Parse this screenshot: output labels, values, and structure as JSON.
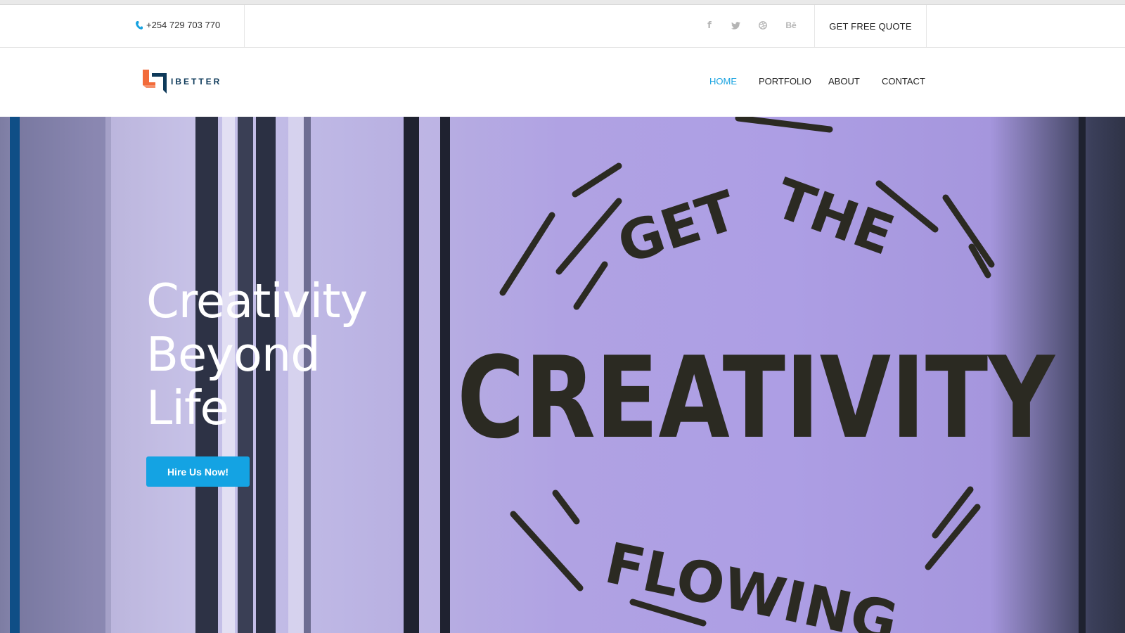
{
  "topbar": {
    "phone": "+254 729 703 770",
    "social": [
      {
        "icon": "facebook-icon",
        "glyph": "f"
      },
      {
        "icon": "twitter-icon",
        "glyph": "t"
      },
      {
        "icon": "dribbble-icon",
        "glyph": "⊛"
      },
      {
        "icon": "behance-icon",
        "glyph": "Bē"
      }
    ],
    "quote_label": "GET FREE QUOTE"
  },
  "brand": {
    "name": "IBETTER",
    "colors": {
      "orange": "#f26b3a",
      "navy": "#0e3a5a"
    }
  },
  "nav": {
    "items": [
      {
        "label": "HOME",
        "active": true
      },
      {
        "label": "PORTFOLIO",
        "active": false
      },
      {
        "label": "ABOUT",
        "active": false
      },
      {
        "label": "CONTACT",
        "active": false
      }
    ],
    "active_color": "#17a2e0"
  },
  "hero": {
    "title_lines": [
      "Creativity",
      "Beyond",
      "Life"
    ],
    "cta_label": "Hire Us Now!",
    "cta_color": "#14a3e3",
    "background_words": [
      "GET THE",
      "CREATIVITY",
      "FLOWING"
    ]
  }
}
